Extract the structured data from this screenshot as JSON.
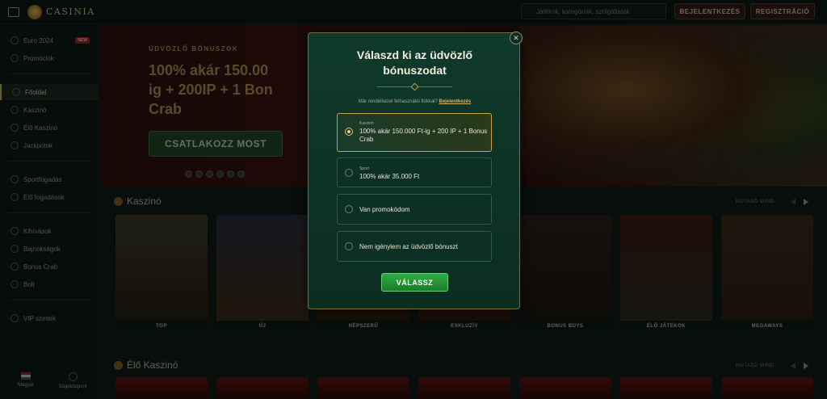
{
  "app": {
    "brand": "CASINIA"
  },
  "header": {
    "search_placeholder": "Játékok, kategóriák, szolgáltatók",
    "login_label": "BEJELENTKEZÉS",
    "register_label": "REGISZTRÁCIÓ"
  },
  "sidebar": {
    "items": [
      {
        "label": "Euro 2024",
        "badge": "NEW",
        "icon": "trophy-icon"
      },
      {
        "label": "Promóciók",
        "icon": "gift-icon"
      },
      {
        "label": "Főoldal",
        "icon": "home-icon",
        "active": true
      },
      {
        "label": "Kaszinó",
        "icon": "slot-icon"
      },
      {
        "label": "Élő Kaszinó",
        "icon": "live-icon"
      },
      {
        "label": "Jackpotok",
        "icon": "jackpot-icon"
      },
      {
        "label": "Sportfogadás",
        "icon": "ball-icon"
      },
      {
        "label": "Élő fogadások",
        "icon": "live-bet-icon"
      },
      {
        "label": "Kihívások",
        "icon": "challenge-icon"
      },
      {
        "label": "Bajnokságok",
        "icon": "tournament-icon"
      },
      {
        "label": "Bonus Crab",
        "icon": "crab-icon"
      },
      {
        "label": "Bolt",
        "icon": "shop-icon"
      },
      {
        "label": "VIP szintek",
        "icon": "crown-icon"
      }
    ],
    "footer": {
      "language": "Magyar",
      "help": "Súgóközpont"
    }
  },
  "hero": {
    "tag": "ÜDVÖZLŐ BÓNUSZOK",
    "title": "100% akár 150.00\nig + 200IP + 1 Bon\nCrab",
    "cta": "CSATLAKOZZ MOST"
  },
  "sections": {
    "casino": {
      "title": "Kaszinó",
      "show_more": "MUTASD MIND"
    },
    "live": {
      "title": "Élő Kaszinó",
      "show_more": "MUTASD MIND"
    }
  },
  "casino_cards": [
    "TOP",
    "ÚJ",
    "NÉPSZERŰ",
    "EXKLUZÍV",
    "BONUS BUYS",
    "ÉLŐ JÁTÉKOK",
    "MEGAWAYS"
  ],
  "modal": {
    "title": "Válaszd ki az üdvözlő\nbónuszodat",
    "login_prompt": "Már rendelkezel felhasználói fiókkal?",
    "login_link": "Bejelentkezés",
    "options": [
      {
        "category": "Kaszinó",
        "label": "100% akár 150.000 Ft-ig + 200 IP + 1 Bonus Crab",
        "selected": true
      },
      {
        "category": "Sport",
        "label": "100% akár 35.000 Ft",
        "selected": false
      },
      {
        "category": "",
        "label": "Van promokódom",
        "selected": false
      },
      {
        "category": "",
        "label": "Nem igénylem az üdvözlő bónuszt",
        "selected": false
      }
    ],
    "confirm_label": "VÁLASSZ",
    "close_symbol": "✕"
  },
  "colors": {
    "accent_gold": "#c9a44a",
    "confirm_green": "#2fae43",
    "modal_bg": "#0f3a2c"
  }
}
